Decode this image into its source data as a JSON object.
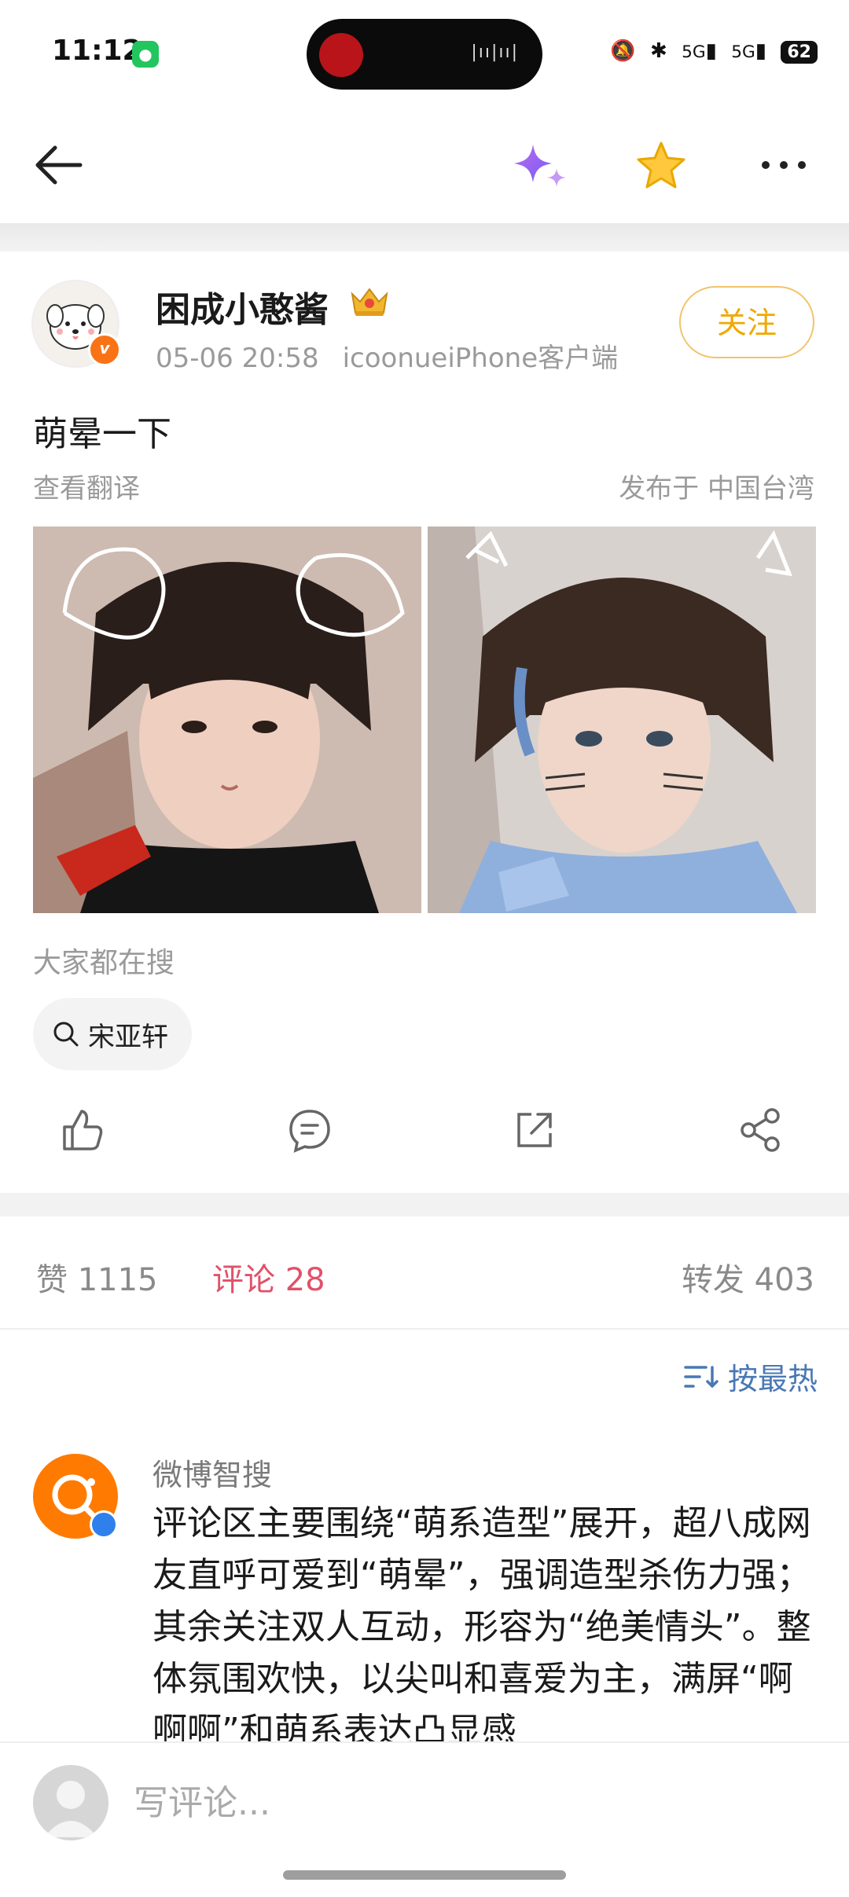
{
  "status_bar": {
    "time": "11:12",
    "network_1": "5G",
    "network_2": "5G",
    "battery": "62"
  },
  "nav": {
    "back_icon": "arrow-left-icon",
    "ai_icon": "sparkle-icon",
    "favorite_icon": "star-icon",
    "more_icon": "more-dots-icon"
  },
  "post": {
    "username": "困成小憨酱",
    "timestamp": "05-06 20:58",
    "source": "icoonueiPhone客户端",
    "follow_label": "关注",
    "text": "萌晕一下",
    "translate_label": "查看翻译",
    "location": "发布于 中国台湾",
    "trending_label": "大家都在搜",
    "search_chip": "宋亚轩"
  },
  "stats": {
    "likes": "赞 1115",
    "comments": "评论 28",
    "reposts": "转发 403"
  },
  "sort_label": "按最热",
  "ai_comment": {
    "name": "微博智搜",
    "text": "评论区主要围绕“萌系造型”展开，超八成网友直呼可爱到“萌晕”，强调造型杀伤力强；其余关注双人互动，形容为“绝美情头”。整体氛围欢快，以尖叫和喜爱为主，满屏“啊啊啊”和萌系表达凸显感"
  },
  "compose": {
    "placeholder": "写评论..."
  },
  "colors": {
    "accent_orange": "#f0a800",
    "comment_red": "#e0516a",
    "link_blue": "#4a78b5"
  }
}
